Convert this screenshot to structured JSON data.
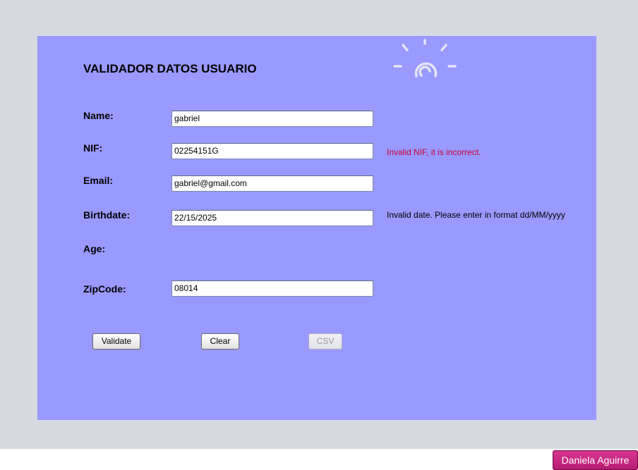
{
  "form": {
    "title": "VALIDADOR DATOS USUARIO",
    "fields": {
      "name": {
        "label": "Name:",
        "value": "gabriel"
      },
      "nif": {
        "label": "NIF:",
        "value": "02254151G",
        "error": "Invalid NIF, it is incorrect."
      },
      "email": {
        "label": "Email:",
        "value": "gabriel@gmail.com"
      },
      "birthdate": {
        "label": "Birthdate:",
        "value": "22/15/2025",
        "error": "Invalid date. Please enter in format dd/MM/yyyy"
      },
      "age": {
        "label": "Age:"
      },
      "zipcode": {
        "label": "ZipCode:",
        "value": "08014"
      }
    },
    "buttons": {
      "validate": "Validate",
      "clear": "Clear",
      "csv": "CSV"
    }
  },
  "user": {
    "name": "Daniela Aguirre"
  },
  "colors": {
    "panel": "#9999ff",
    "background": "#d6d9e0",
    "nif_error": "#cc0033",
    "date_message": "#000000",
    "user_chip": "#c42a80"
  },
  "icons": [
    "lightbulb-logo-icon"
  ]
}
